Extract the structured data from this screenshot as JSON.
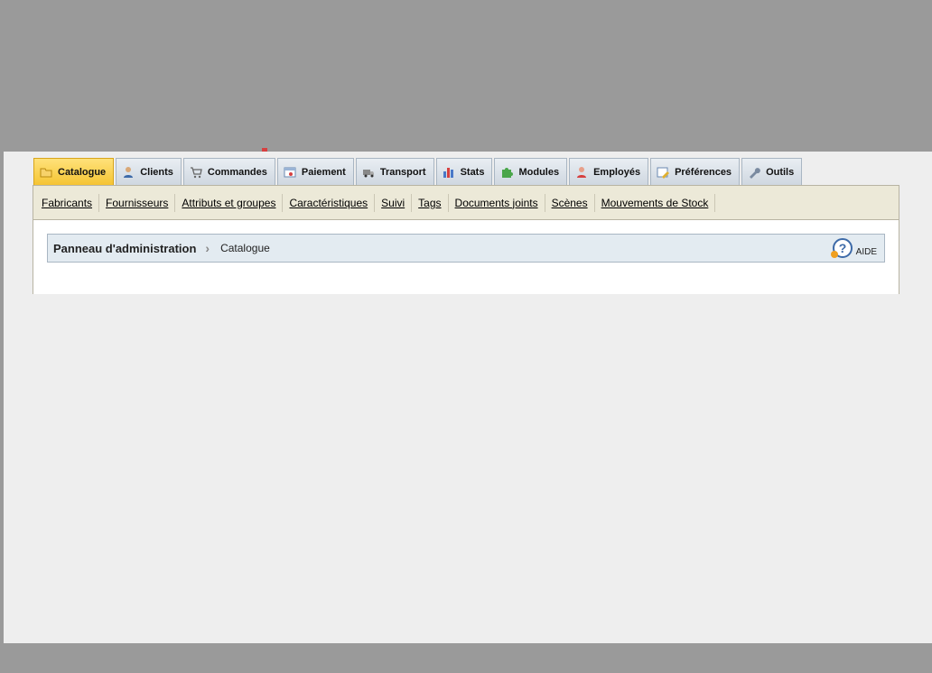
{
  "tabs": [
    {
      "label": "Catalogue",
      "icon": "folder-icon",
      "active": true
    },
    {
      "label": "Clients",
      "icon": "user-icon"
    },
    {
      "label": "Commandes",
      "icon": "cart-icon"
    },
    {
      "label": "Paiement",
      "icon": "payment-icon"
    },
    {
      "label": "Transport",
      "icon": "truck-icon"
    },
    {
      "label": "Stats",
      "icon": "bar-chart-icon"
    },
    {
      "label": "Modules",
      "icon": "puzzle-icon"
    },
    {
      "label": "Employés",
      "icon": "employee-icon"
    },
    {
      "label": "Préférences",
      "icon": "preferences-icon"
    },
    {
      "label": "Outils",
      "icon": "wrench-icon"
    }
  ],
  "subnav": [
    {
      "label": "Fabricants"
    },
    {
      "label": "Fournisseurs"
    },
    {
      "label": "Attributs et groupes"
    },
    {
      "label": "Caractéristiques"
    },
    {
      "label": "Suivi"
    },
    {
      "label": "Tags"
    },
    {
      "label": "Documents joints"
    },
    {
      "label": "Scènes"
    },
    {
      "label": "Mouvements de Stock"
    }
  ],
  "breadcrumb": {
    "home": "Panneau d'administration",
    "current": "Catalogue"
  },
  "help": {
    "label": "AIDE",
    "icon": "help-icon"
  },
  "colors": {
    "active_tab": "#f5c433",
    "tab": "#cfd7e0",
    "subbar": "#ece9d8",
    "breadcrumb_bg": "#e3ebf1"
  }
}
